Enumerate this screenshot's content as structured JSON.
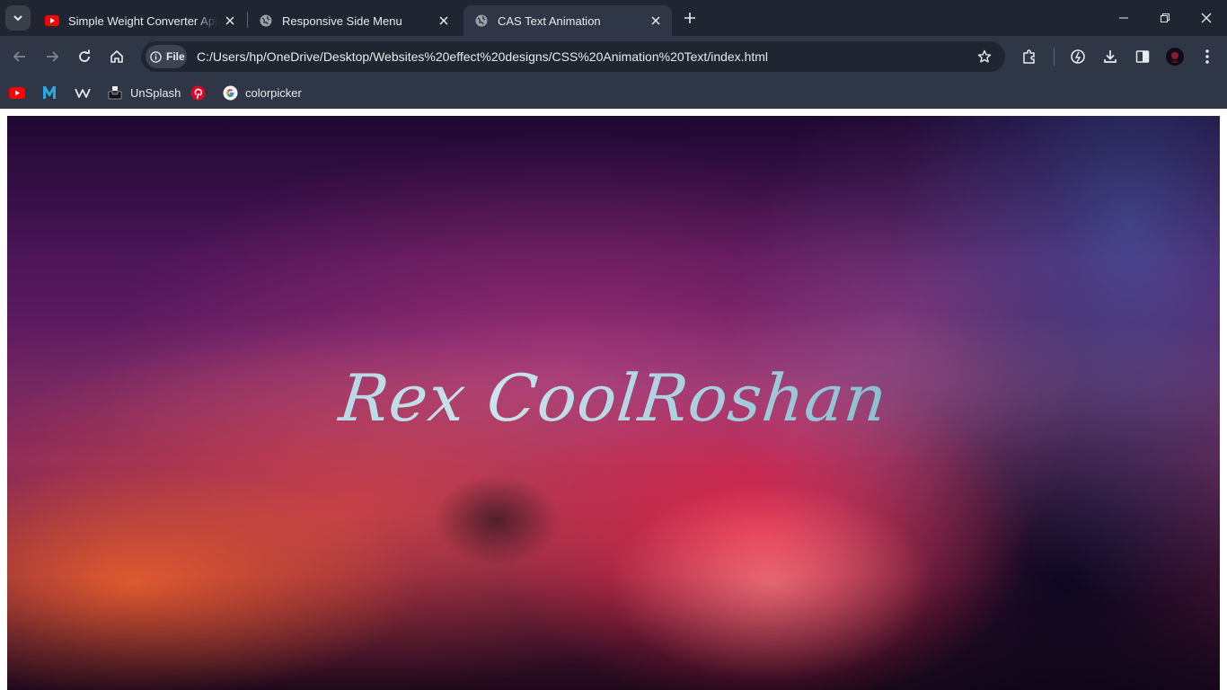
{
  "browser": {
    "tabs": [
      {
        "title": "Simple Weight Converter App Using HTML CSS",
        "favicon": "youtube-icon",
        "active": false
      },
      {
        "title": "Responsive Side Menu",
        "favicon": "globe-icon",
        "active": false
      },
      {
        "title": "CAS Text Animation",
        "favicon": "globe-icon",
        "active": true
      }
    ],
    "address_bar": {
      "security_chip": "File",
      "url": "C:/Users/hp/OneDrive/Desktop/Websites%20effect%20designs/CSS%20Animation%20Text/index.html"
    },
    "bookmarks": [
      {
        "label": "",
        "icon": "youtube-icon"
      },
      {
        "label": "",
        "icon": "m-logo-icon"
      },
      {
        "label": "",
        "icon": "webflow-icon"
      },
      {
        "label": "UnSplash",
        "icon": "unsplash-icon"
      },
      {
        "label": "",
        "icon": "pinterest-icon"
      },
      {
        "label": "colorpicker",
        "icon": "google-icon"
      }
    ],
    "colors": {
      "tabstrip": "#1f2531",
      "toolbar": "#2f3747",
      "omnibox": "#1f2531"
    }
  },
  "page": {
    "hero_text": "Rex CoolRoshan",
    "text_color": "#a9d3df"
  }
}
